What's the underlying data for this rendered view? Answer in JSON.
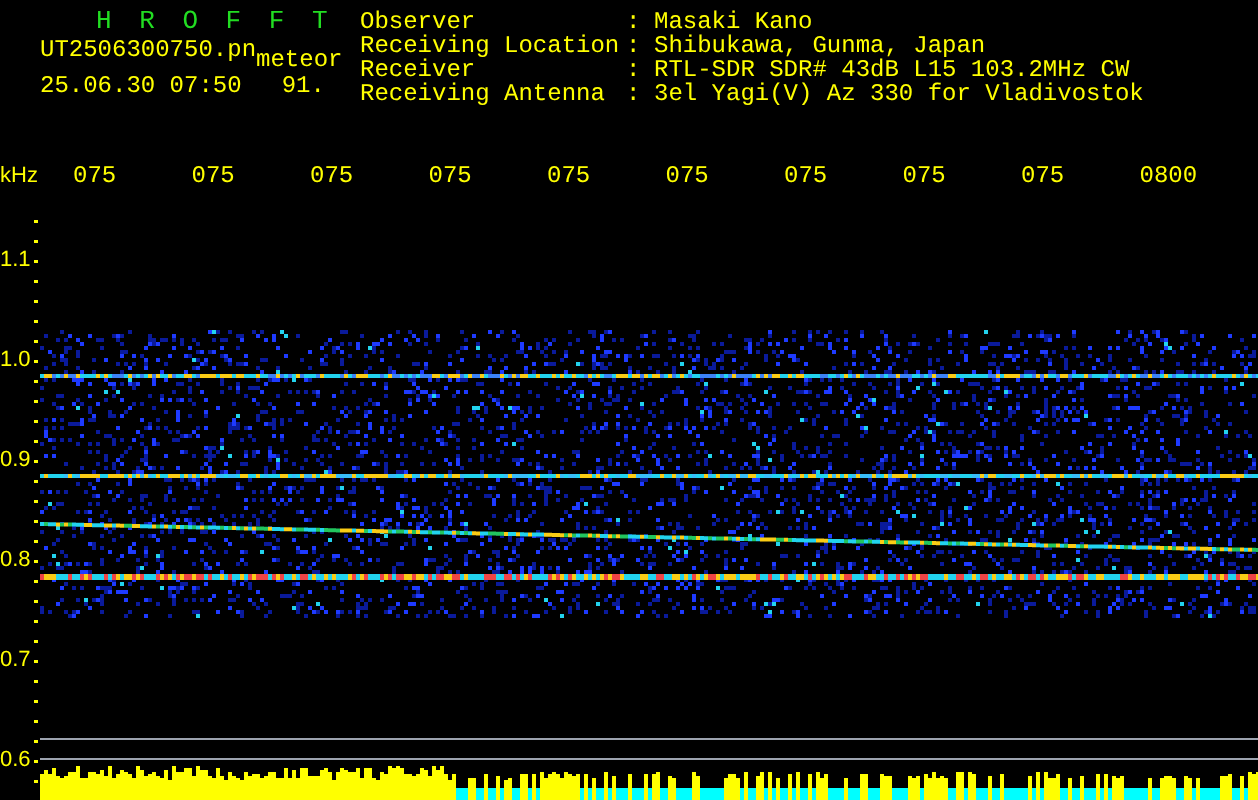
{
  "header": {
    "title": "H R O F F T",
    "file": "UT2506300750.pn",
    "tag": "meteor",
    "timestamp": "25.06.30 07:50",
    "count": "91."
  },
  "info": [
    {
      "label": "Observer",
      "value": "Masaki Kano"
    },
    {
      "label": "Receiving Location",
      "value": "Shibukawa, Gunma, Japan"
    },
    {
      "label": "Receiver",
      "value": "RTL-SDR SDR# 43dB L15 103.2MHz CW"
    },
    {
      "label": "Receiving Antenna",
      "value": "3el Yagi(V) Az 330 for Vladivostok"
    }
  ],
  "separator": ":",
  "axis": {
    "unit": "kHz",
    "y_labels": [
      "1.1",
      "1.0",
      "0.9",
      "0.8",
      "0.7",
      "0.6"
    ],
    "time_labels": [
      "075",
      "075",
      "075",
      "075",
      "075",
      "075",
      "075",
      "075",
      "075",
      "0800"
    ]
  }
}
